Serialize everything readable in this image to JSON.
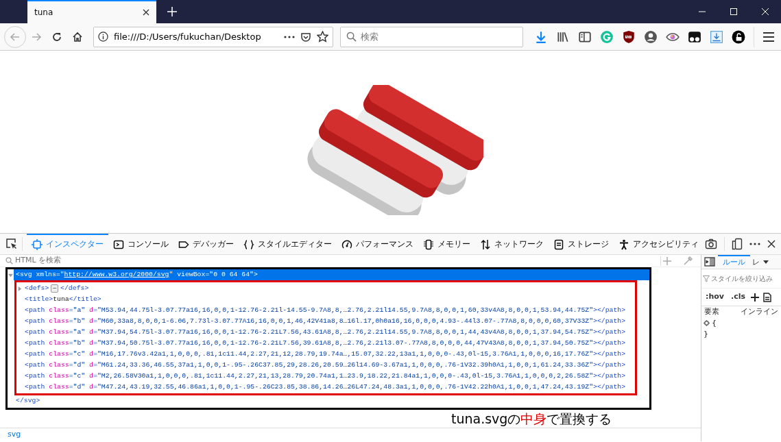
{
  "browser_tabs": [
    {
      "label": "tuna",
      "selected": true
    }
  ],
  "address_bar": {
    "value": "file:///D:/Users/fukuchan/Desktop"
  },
  "search_bar": {
    "placeholder": "検索"
  },
  "devtools": {
    "tabs": [
      {
        "label": "インスペクター",
        "kind": "inspector",
        "selected": true
      },
      {
        "label": "コンソール",
        "kind": "console",
        "selected": false
      },
      {
        "label": "デバッガー",
        "kind": "debugger",
        "selected": false
      },
      {
        "label": "スタイルエディター",
        "kind": "style",
        "selected": false
      },
      {
        "label": "パフォーマンス",
        "kind": "performance",
        "selected": false
      },
      {
        "label": "メモリー",
        "kind": "memory",
        "selected": false
      },
      {
        "label": "ネットワーク",
        "kind": "network",
        "selected": false
      },
      {
        "label": "ストレージ",
        "kind": "storage",
        "selected": false
      },
      {
        "label": "アクセシビリティ",
        "kind": "accessibility",
        "selected": false
      }
    ],
    "html_search": {
      "placeholder": "HTML を検索"
    },
    "markup": {
      "selected": true,
      "expanded": true,
      "parts": [
        {
          "kind": "tag",
          "text": "<svg "
        },
        {
          "kind": "attr",
          "text": "xmlns"
        },
        {
          "kind": "tag",
          "text": "="
        },
        {
          "kind": "val",
          "text": "\""
        },
        {
          "kind": "link",
          "text": "http://www.w3.org/2000/svg"
        },
        {
          "kind": "val",
          "text": "\" "
        },
        {
          "kind": "attr",
          "text": "viewBox"
        },
        {
          "kind": "tag",
          "text": "="
        },
        {
          "kind": "val",
          "text": "\"0 0 64 64\""
        },
        {
          "kind": "tag",
          "text": ">"
        }
      ],
      "children": [
        {
          "expanded": false,
          "parts": [
            {
              "kind": "tag",
              "text": "<defs>"
            },
            {
              "kind": "more",
              "text": "⋯"
            },
            {
              "kind": "tag",
              "text": "</defs>"
            }
          ]
        },
        {
          "parts": [
            {
              "kind": "tag",
              "text": "<title>"
            },
            {
              "kind": "text",
              "text": "tuna"
            },
            {
              "kind": "tag",
              "text": "</title>"
            }
          ]
        },
        {
          "parts": [
            {
              "kind": "tag",
              "text": "<path "
            },
            {
              "kind": "attr",
              "text": "class"
            },
            {
              "kind": "tag",
              "text": "="
            },
            {
              "kind": "val",
              "text": "\"a\" "
            },
            {
              "kind": "attr",
              "text": "d"
            },
            {
              "kind": "tag",
              "text": "="
            },
            {
              "kind": "val",
              "text": "\"M53.94,44.75l-3.07.77a16,16,0,0,1-12.76-2.21l-14.55-9.7A8,8,…2.76,2.21l14.55,9.7A8,8,0,0,1,60,33v4A8,8,0,0,1,53.94,44.75Z\""
            },
            {
              "kind": "tag",
              "text": "></path>"
            }
          ]
        },
        {
          "parts": [
            {
              "kind": "tag",
              "text": "<path "
            },
            {
              "kind": "attr",
              "text": "class"
            },
            {
              "kind": "tag",
              "text": "="
            },
            {
              "kind": "val",
              "text": "\"b\" "
            },
            {
              "kind": "attr",
              "text": "d"
            },
            {
              "kind": "tag",
              "text": "="
            },
            {
              "kind": "val",
              "text": "\"M60,33a8,8,0,0,1-6.06,7.73l-3.07.77A16,16,0,0,1,46,42V41a8,8…16l.17,0h0a16,16,0,0,0,4.93-.44l3.07-.77A8,8,0,0,0,60,37V33Z\""
            },
            {
              "kind": "tag",
              "text": "></path>"
            }
          ]
        },
        {
          "parts": [
            {
              "kind": "tag",
              "text": "<path "
            },
            {
              "kind": "attr",
              "text": "class"
            },
            {
              "kind": "tag",
              "text": "="
            },
            {
              "kind": "val",
              "text": "\"a\" "
            },
            {
              "kind": "attr",
              "text": "d"
            },
            {
              "kind": "tag",
              "text": "="
            },
            {
              "kind": "val",
              "text": "\"M37.94,54.75l-3.07.77a16,16,0,0,1-12.76-2.21L7.56,43.61A8,8,…2.76,2.21l14.55,9.7A8,8,0,0,1,44,43v4A8,8,0,0,1,37.94,54.75Z\""
            },
            {
              "kind": "tag",
              "text": "></path>"
            }
          ]
        },
        {
          "parts": [
            {
              "kind": "tag",
              "text": "<path "
            },
            {
              "kind": "attr",
              "text": "class"
            },
            {
              "kind": "tag",
              "text": "="
            },
            {
              "kind": "val",
              "text": "\"b\" "
            },
            {
              "kind": "attr",
              "text": "d"
            },
            {
              "kind": "tag",
              "text": "="
            },
            {
              "kind": "val",
              "text": "\"M37.94,50.75l-3.07.77a16,16,0,0,1-12.76-2.21L7.56,39.61A8,8,…2.76,2.21l3.07-.77A8,8,0,0,0,44,47V43A8,8,0,0,1,37.94,50.75Z\""
            },
            {
              "kind": "tag",
              "text": "></path>"
            }
          ]
        },
        {
          "parts": [
            {
              "kind": "tag",
              "text": "<path "
            },
            {
              "kind": "attr",
              "text": "class"
            },
            {
              "kind": "tag",
              "text": "="
            },
            {
              "kind": "val",
              "text": "\"c\" "
            },
            {
              "kind": "attr",
              "text": "d"
            },
            {
              "kind": "tag",
              "text": "="
            },
            {
              "kind": "val",
              "text": "\"M16,17.76v3.42a1,1,0,0,0,.81,1c11.44,2.27,21,12,28.79,19.74a…,15.07,32.22,13a1,1,0,0,0-.43,0l-15,3.76A1,1,0,0,0,16,17.76Z\""
            },
            {
              "kind": "tag",
              "text": "></path>"
            }
          ]
        },
        {
          "parts": [
            {
              "kind": "tag",
              "text": "<path "
            },
            {
              "kind": "attr",
              "text": "class"
            },
            {
              "kind": "tag",
              "text": "="
            },
            {
              "kind": "val",
              "text": "\"d\" "
            },
            {
              "kind": "attr",
              "text": "d"
            },
            {
              "kind": "tag",
              "text": "="
            },
            {
              "kind": "val",
              "text": "\"M61.24,33.36,46.55,37a1,1,0,0,1-.95-.26C37.85,29,28.26,20.59…26l14.69-3.67a1,1,0,0,0,.76-1V32.39h0A1,1,0,0,1,61.24,33.36Z\""
            },
            {
              "kind": "tag",
              "text": "></path>"
            }
          ]
        },
        {
          "parts": [
            {
              "kind": "tag",
              "text": "<path "
            },
            {
              "kind": "attr",
              "text": "class"
            },
            {
              "kind": "tag",
              "text": "="
            },
            {
              "kind": "val",
              "text": "\"c\" "
            },
            {
              "kind": "attr",
              "text": "d"
            },
            {
              "kind": "tag",
              "text": "="
            },
            {
              "kind": "val",
              "text": "\"M2,26.58V30a1,1,0,0,0,.81,1c11.44,2.27,21,13,28.79,20.74a1,1…23.9,18.22,21.84a1,1,0,0,0-.43,0l-15,3.76A1,1,0,0,0,2,26.58Z\""
            },
            {
              "kind": "tag",
              "text": "></path>"
            }
          ]
        },
        {
          "parts": [
            {
              "kind": "tag",
              "text": "<path "
            },
            {
              "kind": "attr",
              "text": "class"
            },
            {
              "kind": "tag",
              "text": "="
            },
            {
              "kind": "val",
              "text": "\"d\" "
            },
            {
              "kind": "attr",
              "text": "d"
            },
            {
              "kind": "tag",
              "text": "="
            },
            {
              "kind": "val",
              "text": "\"M47.24,43.19,32.55,46.86a1,1,0,0,1-.95-.26C23.85,38.86,14.26…26L47.24,48.3a1,1,0,0,0,.76-1V42.22h0A1,1,0,0,1,47.24,43.19Z\""
            },
            {
              "kind": "tag",
              "text": "></path>"
            }
          ]
        }
      ],
      "closing": [
        {
          "kind": "tag",
          "text": "</svg>"
        }
      ]
    },
    "annotation": [
      {
        "text": "tuna.svgの",
        "emphasis": false
      },
      {
        "text": "中身",
        "emphasis": true
      },
      {
        "text": "で置換する",
        "emphasis": false
      }
    ],
    "breadcrumbs": [
      "svg"
    ],
    "sidebar_tabs": [
      {
        "label": "ルール",
        "selected": true
      },
      {
        "label": "レ",
        "selected": false
      }
    ],
    "rules_filter": {
      "placeholder": "スタイルを絞り込み"
    },
    "rules_buttons": [
      ":hov",
      ".cls"
    ],
    "rule": {
      "selector": "要素",
      "source": "インライン",
      "open": "{",
      "close": "}"
    }
  }
}
